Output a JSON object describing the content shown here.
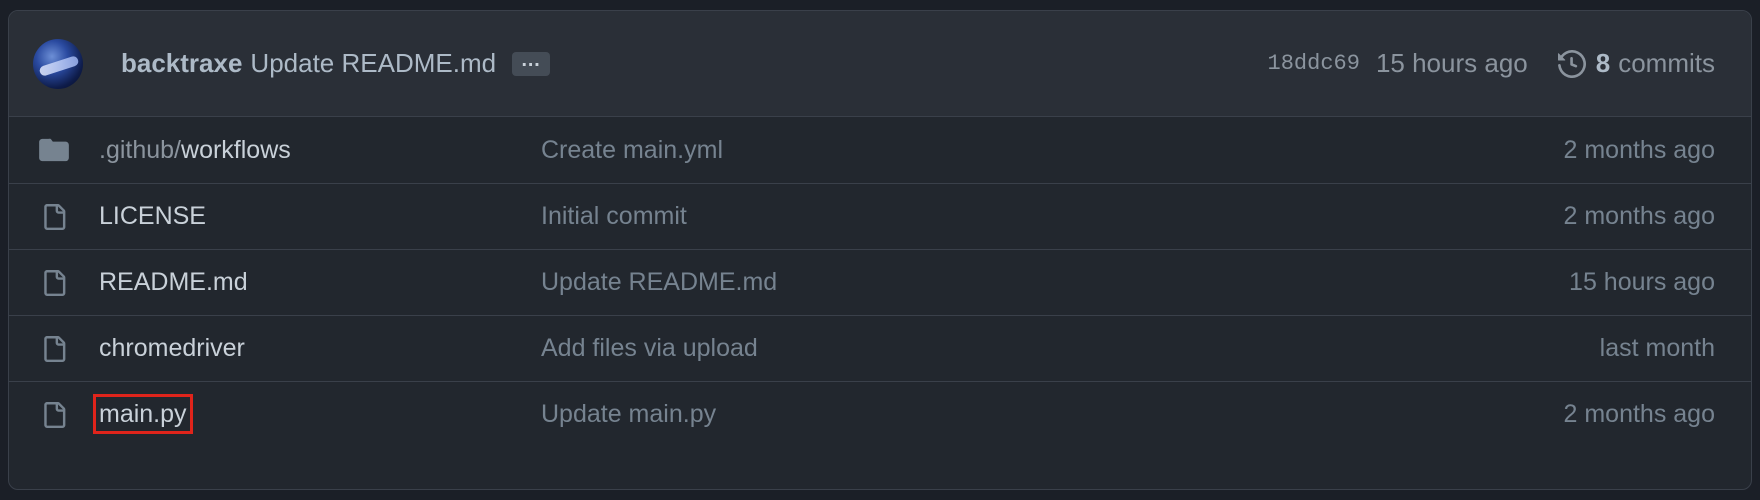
{
  "latest_commit": {
    "author": "backtraxe",
    "message": "Update README.md",
    "ellipsis": "…",
    "sha": "18ddc69",
    "time": "15 hours ago",
    "commits_count": "8",
    "commits_label": "commits"
  },
  "files": [
    {
      "type": "folder",
      "prefix": ".github/",
      "name": "workflows",
      "message": "Create main.yml",
      "age": "2 months ago"
    },
    {
      "type": "file",
      "prefix": "",
      "name": "LICENSE",
      "message": "Initial commit",
      "age": "2 months ago"
    },
    {
      "type": "file",
      "prefix": "",
      "name": "README.md",
      "message": "Update README.md",
      "age": "15 hours ago"
    },
    {
      "type": "file",
      "prefix": "",
      "name": "chromedriver",
      "message": "Add files via upload",
      "age": "last month"
    },
    {
      "type": "file",
      "prefix": "",
      "name": "main.py",
      "message": "Update main.py",
      "age": "2 months ago",
      "highlighted": true
    }
  ],
  "colors": {
    "background": "#22272e",
    "header": "#2a2f37",
    "border": "#3a404a",
    "highlight": "#e0241b"
  },
  "icons": {
    "folder": "folder-icon",
    "file": "file-icon",
    "history": "history-icon"
  }
}
